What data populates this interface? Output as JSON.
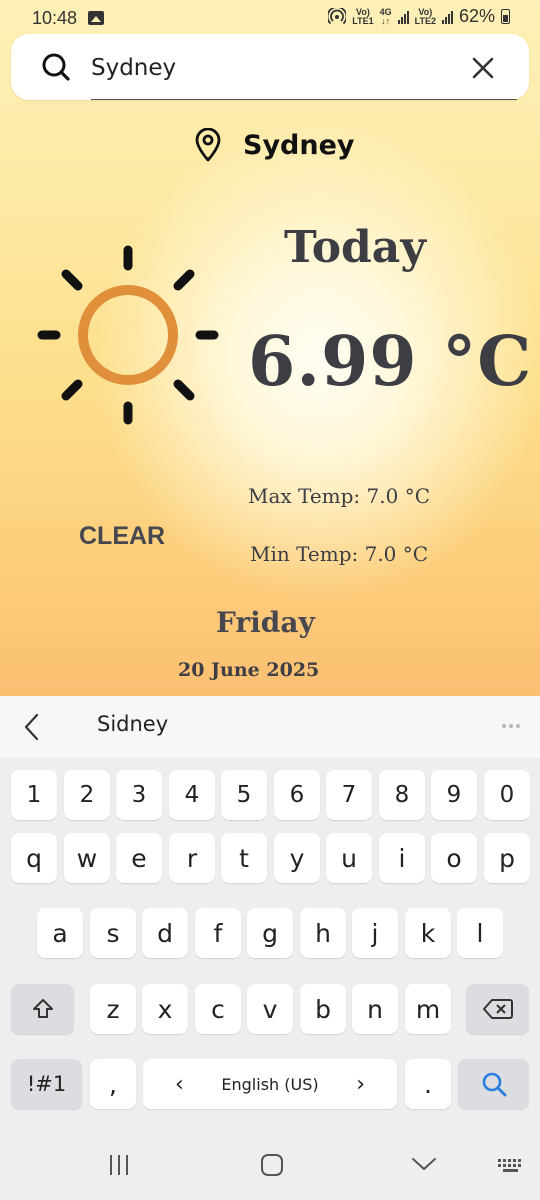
{
  "status": {
    "time": "10:48",
    "sim1_top": "Vo)",
    "sim1_bottom": "LTE1",
    "net_top": "4G",
    "net_bottom": "↓↑",
    "sim2_top": "Vo)",
    "sim2_bottom": "LTE2",
    "battery": "62%"
  },
  "search": {
    "value": "Sydney"
  },
  "weather": {
    "city": "Sydney",
    "today_label": "Today",
    "temperature": "6.99 °C",
    "max_temp": "Max Temp: 7.0 °C",
    "min_temp": "Min Temp: 7.0 °C",
    "condition": "CLEAR",
    "day": "Friday",
    "date": "20 June 2025",
    "icon": "sun-icon",
    "sun_color": "#e0903a"
  },
  "keyboard": {
    "suggestion": "Sidney",
    "row_numbers": [
      "1",
      "2",
      "3",
      "4",
      "5",
      "6",
      "7",
      "8",
      "9",
      "0"
    ],
    "row_1": [
      "q",
      "w",
      "e",
      "r",
      "t",
      "y",
      "u",
      "i",
      "o",
      "p"
    ],
    "row_2": [
      "a",
      "s",
      "d",
      "f",
      "g",
      "h",
      "j",
      "k",
      "l"
    ],
    "row_3": [
      "z",
      "x",
      "c",
      "v",
      "b",
      "n",
      "m"
    ],
    "symbols_key": "!#1",
    "comma_key": ",",
    "space_label": "English (US)",
    "space_left_arrow": "‹",
    "space_right_arrow": "›",
    "period_key": ".",
    "search_key_color": "#2a7de1"
  },
  "nav": {
    "icons": [
      "recent-apps-icon",
      "home-icon",
      "back-icon",
      "keyboard-switch-icon"
    ]
  }
}
